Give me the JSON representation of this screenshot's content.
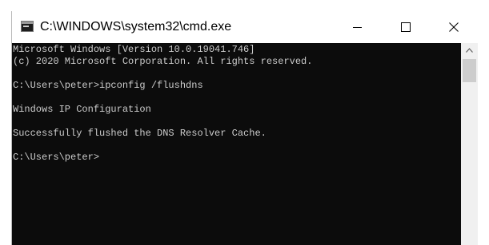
{
  "window": {
    "title": "C:\\WINDOWS\\system32\\cmd.exe",
    "app_icon": "cmd-icon",
    "controls": {
      "minimize_icon": "minimize-icon",
      "maximize_icon": "maximize-icon",
      "close_icon": "close-icon"
    }
  },
  "console": {
    "background": "#0c0c0c",
    "foreground": "#cccccc",
    "lines": [
      "Microsoft Windows [Version 10.0.19041.746]",
      "(c) 2020 Microsoft Corporation. All rights reserved.",
      "",
      "C:\\Users\\peter>ipconfig /flushdns",
      "",
      "Windows IP Configuration",
      "",
      "Successfully flushed the DNS Resolver Cache.",
      "",
      "C:\\Users\\peter>"
    ]
  },
  "scrollbar": {
    "up_icon": "chevron-up-icon"
  }
}
